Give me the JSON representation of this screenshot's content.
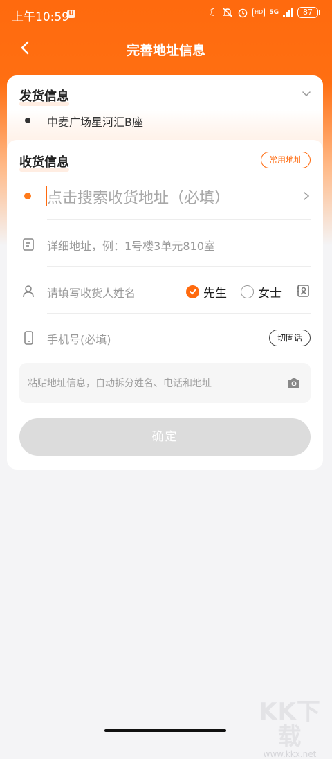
{
  "status_bar": {
    "time": "上午10:59",
    "notification_badge": "U",
    "network_label": "5G",
    "hd_label": "HD",
    "battery": "87",
    "icons": [
      "moon-icon",
      "mute-icon",
      "alarm-icon",
      "hd-icon",
      "signal-icon",
      "battery-icon"
    ]
  },
  "header": {
    "title": "完善地址信息",
    "back_icon": "chevron-left-icon"
  },
  "sender": {
    "section_title": "发货信息",
    "address": "中麦广场星河汇B座",
    "expand_icon": "chevron-down-icon"
  },
  "receiver": {
    "section_title": "收货信息",
    "common_address_label": "常用地址",
    "search_address_placeholder": "点击搜索收货地址（必填）",
    "detail_placeholder": "详细地址，例：1号楼3单元810室",
    "name_placeholder": "请填写收货人姓名",
    "gender_options": [
      {
        "label": "先生",
        "selected": true
      },
      {
        "label": "女士",
        "selected": false
      }
    ],
    "phone_placeholder": "手机号(必填)",
    "landline_label": "切固话",
    "paste_placeholder": "粘贴地址信息，自动拆分姓名、电话和地址",
    "confirm_label": "确定"
  },
  "colors": {
    "accent": "#ff6a0e",
    "confirm_disabled": "#dcdcdc",
    "background": "#f4f4f6"
  },
  "watermark": {
    "logo": "KK下载",
    "url": "www.kkx.net"
  }
}
